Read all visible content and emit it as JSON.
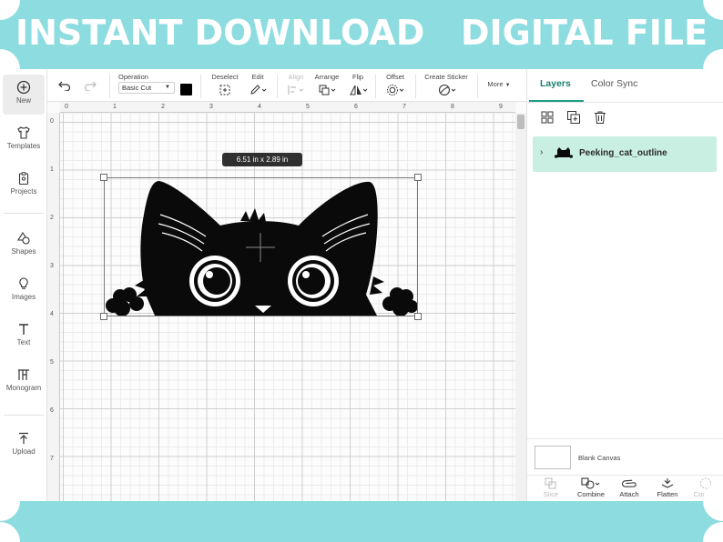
{
  "banner": {
    "title": "INSTANT DOWNLOAD   DIGITAL FILE",
    "color": "#8ddcdf"
  },
  "left_sidebar": {
    "items": [
      {
        "label": "New",
        "icon": "plus-circle-icon",
        "active": true
      },
      {
        "label": "Templates",
        "icon": "shirt-icon"
      },
      {
        "label": "Projects",
        "icon": "clipboard-icon"
      },
      {
        "label": "Shapes",
        "icon": "shapes-icon"
      },
      {
        "label": "Images",
        "icon": "lightbulb-icon"
      },
      {
        "label": "Text",
        "icon": "text-icon"
      },
      {
        "label": "Monogram",
        "icon": "monogram-icon"
      },
      {
        "label": "Upload",
        "icon": "upload-icon"
      }
    ]
  },
  "toolbar": {
    "undo_icon": "undo-icon",
    "redo_icon": "redo-icon",
    "operation_label": "Operation",
    "operation_value": "Basic Cut",
    "color_swatch": "#000000",
    "deselect_label": "Deselect",
    "edit_label": "Edit",
    "align_label": "Align",
    "arrange_label": "Arrange",
    "flip_label": "Flip",
    "offset_label": "Offset",
    "create_sticker_label": "Create Sticker",
    "more_label": "More"
  },
  "canvas": {
    "ruler_top": [
      "0",
      "1",
      "2",
      "3",
      "4",
      "5",
      "6",
      "7",
      "8",
      "9"
    ],
    "ruler_left": [
      "0",
      "1",
      "2",
      "3",
      "4",
      "5",
      "6",
      "7"
    ],
    "size_badge": "6.51  in x 2.89  in"
  },
  "right_panel": {
    "tabs": [
      {
        "label": "Layers",
        "active": true
      },
      {
        "label": "Color Sync",
        "active": false
      }
    ],
    "layer_tools": [
      "group-icon",
      "duplicate-icon",
      "trash-icon"
    ],
    "layer": {
      "name": "Peeking_cat_outline"
    },
    "blank_canvas_label": "Blank Canvas",
    "bottom_actions": [
      {
        "label": "Slice",
        "icon": "slice-icon",
        "enabled": false
      },
      {
        "label": "Combine",
        "icon": "combine-icon",
        "enabled": true
      },
      {
        "label": "Attach",
        "icon": "attach-icon",
        "enabled": true
      },
      {
        "label": "Flatten",
        "icon": "flatten-icon",
        "enabled": true
      },
      {
        "label": "Contour",
        "icon": "contour-icon",
        "enabled": false
      }
    ],
    "accent": "#1f9e86",
    "layer_bg": "#c8efe2"
  }
}
